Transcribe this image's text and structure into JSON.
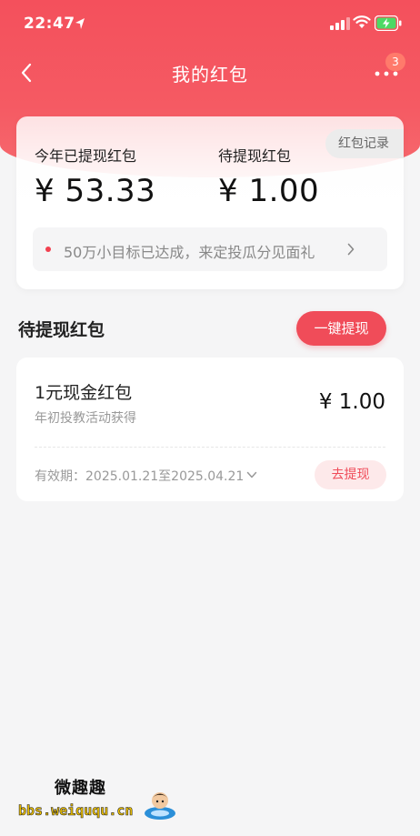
{
  "status_bar": {
    "time": "22:47",
    "icons": [
      "location-arrow-icon",
      "signal-icon",
      "wifi-icon",
      "battery-charging-icon"
    ]
  },
  "nav": {
    "title": "我的红包",
    "back_icon": "chevron-left-icon",
    "more_icon": "more-dots-icon",
    "badge_count": "3"
  },
  "summary": {
    "withdrawn_label": "今年已提现红包",
    "withdrawn_value": "¥ 53.33",
    "pending_label": "待提现红包",
    "pending_value": "¥ 1.00",
    "record_button": "红包记录",
    "notice_text": "50万小目标已达成，来定投瓜分见面礼"
  },
  "section": {
    "title": "待提现红包",
    "withdraw_all_button": "一键提现"
  },
  "coupon": {
    "title": "1元现金红包",
    "subtitle": "年初投教活动获得",
    "amount": "¥ 1.00",
    "validity": "有效期：2025.01.21至2025.04.21",
    "action_button": "去提现"
  },
  "watermark": {
    "name": "微趣趣",
    "url": "bbs.weiququ.cn"
  },
  "colors": {
    "brand_red": "#f04c59",
    "header_red": "#f4505c",
    "light_pink": "#fde9ea"
  }
}
